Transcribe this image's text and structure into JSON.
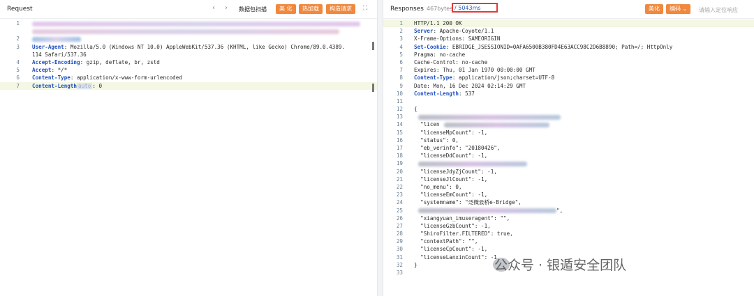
{
  "request": {
    "title": "Request",
    "nav_prev": "‹",
    "nav_next": "›",
    "scan_label": "数据包扫描",
    "beautify": "美 化",
    "hotload": "热加载",
    "construct": "构造请求",
    "expand": "⛶",
    "lines": [
      {
        "n": "1",
        "key": "",
        "rest": ""
      },
      {
        "n": "",
        "key": "",
        "rest": ""
      },
      {
        "n": "2",
        "key": "",
        "rest": ""
      },
      {
        "n": "3",
        "key": "User-Agent",
        "rest": ": Mozilla/5.0 (Windows NT 10.0) AppleWebKit/537.36 (KHTML, like Gecko) Chrome/89.0.4389."
      },
      {
        "n": "",
        "key": "",
        "rest": "114 Safari/537.36"
      },
      {
        "n": "4",
        "key": "Accept-Encoding",
        "rest": ": gzip, deflate, br, zstd"
      },
      {
        "n": "5",
        "key": "Accept",
        "rest": ": */*"
      },
      {
        "n": "6",
        "key": "Content-Type",
        "rest": ": application/x-www-form-urlencoded"
      },
      {
        "n": "7",
        "key": "Content-Length",
        "rest": ": 0",
        "sel": "auto"
      }
    ]
  },
  "response": {
    "title": "Responses",
    "size": "467bytes",
    "time": "/ 5043ms",
    "beautify": "美化",
    "encode": "编码",
    "search_placeholder": "请输入定位响应",
    "lines": [
      {
        "n": "1",
        "key": "",
        "rest": "HTTP/1.1 200 OK"
      },
      {
        "n": "2",
        "key": "Server",
        "rest": ": Apache-Coyote/1.1"
      },
      {
        "n": "3",
        "key": "",
        "rest": "X-Frame-Options: SAMEORIGIN"
      },
      {
        "n": "4",
        "key": "Set-Cookie",
        "rest": ": EBRIDGE_JSESSIONID=0AFA6500B380FD4E63ACC98C2D6B8890; Path=/; HttpOnly"
      },
      {
        "n": "5",
        "key": "",
        "rest": "Pragma: no-cache"
      },
      {
        "n": "6",
        "key": "",
        "rest": "Cache-Control: no-cache"
      },
      {
        "n": "7",
        "key": "",
        "rest": "Expires: Thu, 01 Jan 1970 00:00:00 GMT"
      },
      {
        "n": "8",
        "key": "Content-Type",
        "rest": ": application/json;charset=UTF-8"
      },
      {
        "n": "9",
        "key": "",
        "rest": "Date: Mon, 16 Dec 2024 02:14:29 GMT"
      },
      {
        "n": "10",
        "key": "Content-Length",
        "rest": ": 537"
      },
      {
        "n": "11",
        "key": "",
        "rest": ""
      },
      {
        "n": "12",
        "key": "",
        "rest": "{"
      },
      {
        "n": "13",
        "key": "",
        "rest": "",
        "blur": true
      },
      {
        "n": "14",
        "key": "",
        "rest": "  \"licen",
        "blur": true
      },
      {
        "n": "15",
        "key": "",
        "rest": "  \"licenseMpCount\": -1,"
      },
      {
        "n": "16",
        "key": "",
        "rest": "  \"status\": 0,"
      },
      {
        "n": "17",
        "key": "",
        "rest": "  \"eb_verinfo\": \"20180426\","
      },
      {
        "n": "18",
        "key": "",
        "rest": "  \"licenseDdCount\": -1,"
      },
      {
        "n": "19",
        "key": "",
        "rest": "",
        "blur": true
      },
      {
        "n": "20",
        "key": "",
        "rest": "  \"licenseJdyZjCount\": -1,"
      },
      {
        "n": "21",
        "key": "",
        "rest": "  \"licenseJlCount\": -1,"
      },
      {
        "n": "22",
        "key": "",
        "rest": "  \"no_menu\": 0,"
      },
      {
        "n": "23",
        "key": "",
        "rest": "  \"licenseEmCount\": -1,"
      },
      {
        "n": "24",
        "key": "",
        "rest": "  \"systemname\": \"泛微云桥e-Bridge\","
      },
      {
        "n": "25",
        "key": "",
        "rest": "",
        "blur": true,
        "tail": "\","
      },
      {
        "n": "26",
        "key": "",
        "rest": "  \"xiangyuan_imuseragent\": \"\","
      },
      {
        "n": "27",
        "key": "",
        "rest": "  \"licenseGzbCount\": -1,"
      },
      {
        "n": "28",
        "key": "",
        "rest": "  \"ShiroFilter.FILTERED\": true,"
      },
      {
        "n": "29",
        "key": "",
        "rest": "  \"contextPath\": \"\","
      },
      {
        "n": "30",
        "key": "",
        "rest": "  \"licenseCpCount\": -1,"
      },
      {
        "n": "31",
        "key": "",
        "rest": "  \"licenseLanxinCount\": -1"
      },
      {
        "n": "32",
        "key": "",
        "rest": "}"
      },
      {
        "n": "33",
        "key": "",
        "rest": ""
      }
    ]
  },
  "watermark": "公众号 · 银遁安全团队",
  "colors": {
    "accent": "#f0883e",
    "key": "#1f4fbf",
    "highlight": "#f3f7e3",
    "alert": "#e53935"
  }
}
